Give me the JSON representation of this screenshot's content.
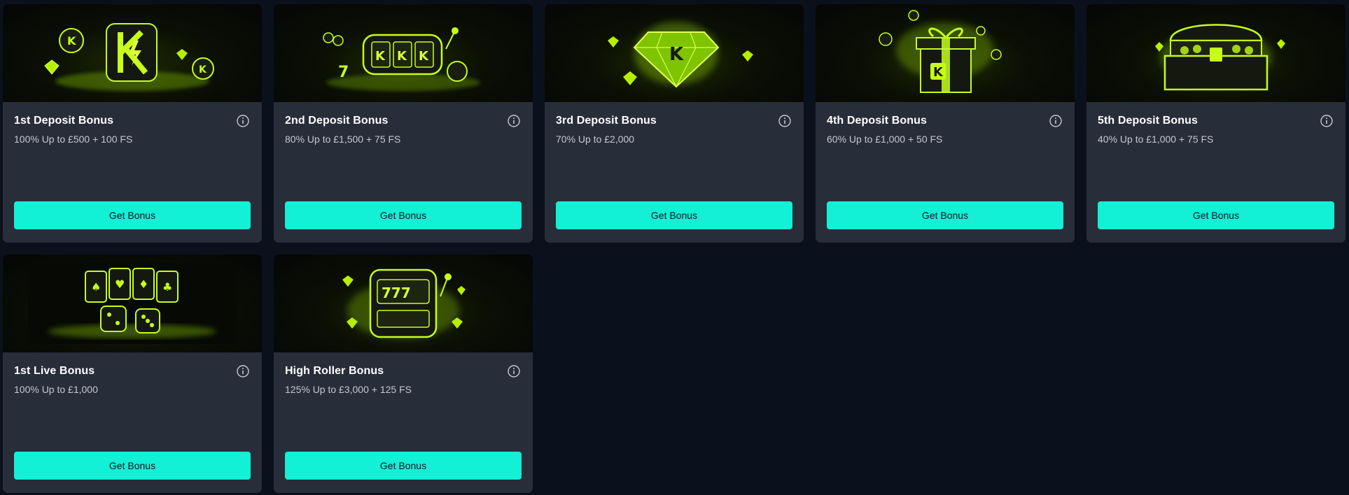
{
  "colors": {
    "page_background": "#0b111c",
    "card_background": "#282d3a",
    "button": "#12f0d6",
    "glow": "#c6ff1a"
  },
  "bonuses": [
    {
      "title": "1st Deposit Bonus",
      "offer": "100% Up to £500 + 100 FS",
      "button": "Get Bonus",
      "art": "k-logo-coins-gems"
    },
    {
      "title": "2nd Deposit Bonus",
      "offer": "80% Up to £1,500 + 75 FS",
      "button": "Get Bonus",
      "art": "slot-reels-kkk"
    },
    {
      "title": "3rd Deposit Bonus",
      "offer": "70% Up to £2,000",
      "button": "Get Bonus",
      "art": "diamond-k"
    },
    {
      "title": "4th Deposit Bonus",
      "offer": "60% Up to £1,000 + 50 FS",
      "button": "Get Bonus",
      "art": "gift-box-k"
    },
    {
      "title": "5th Deposit Bonus",
      "offer": "40% Up to £1,000 + 75 FS",
      "button": "Get Bonus",
      "art": "treasure-chest"
    },
    {
      "title": "1st Live Bonus",
      "offer": "100% Up to £1,000",
      "button": "Get Bonus",
      "art": "cards-chips-dice"
    },
    {
      "title": "High Roller Bonus",
      "offer": "125% Up to £3,000 + 125 FS",
      "button": "Get Bonus",
      "art": "slot-machine-777"
    }
  ]
}
